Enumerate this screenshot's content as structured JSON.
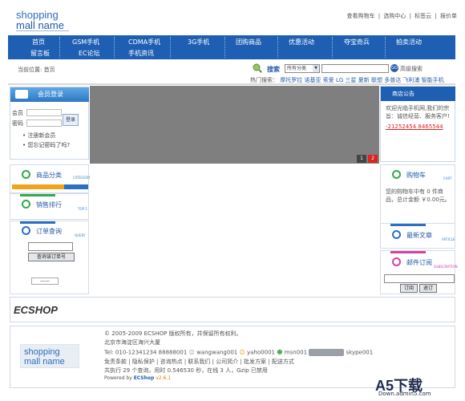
{
  "logo": {
    "line1": "shopping",
    "line2": "mall name"
  },
  "toplinks": [
    "查看购物车",
    "|",
    "选购中心",
    "|",
    "标签云",
    "|",
    "报价单"
  ],
  "nav": {
    "row1": [
      "首页",
      "GSM手机",
      "CDMA手机",
      "3G手机",
      "团购商品",
      "优惠活动",
      "夺宝奇兵",
      "拍卖活动"
    ],
    "row2": [
      "留言板",
      "EC论坛",
      "手机资讯"
    ]
  },
  "breadcrumb": "当前位置: 首页",
  "search": {
    "label": "搜索",
    "category_selected": "所有分类",
    "advanced_label": "高级搜索",
    "hot_prefix": "热门搜索：",
    "hot_words": [
      "摩托罗拉",
      "诺基亚",
      "索爱",
      "LG",
      "三星",
      "夏新",
      "联想",
      "多普达",
      "飞利浦",
      "智能手机"
    ]
  },
  "login": {
    "title": "会员登录",
    "user_label": "会员",
    "pass_label": "密码",
    "login_button": "登录",
    "register_link": "注册新会员",
    "forgot_link": "您忘记密码了吗?"
  },
  "banner": {
    "pages": [
      "1",
      "2"
    ]
  },
  "notice": {
    "title": "商店公告",
    "text": "欢迎光临手机网,我们的宗旨：诚信经营、服务客户!",
    "phone": "-21252454 8465544"
  },
  "left": {
    "category_title": "商品分类",
    "category_tag": "CATEGORY",
    "top10_title": "销售排行",
    "top10_tag": "TOP 5",
    "order_title": "订单查询",
    "order_tag": "QUERY",
    "order_button": "查询该订单号",
    "vote_input": "——"
  },
  "right": {
    "cart_title": "购物车",
    "cart_tag": "CART",
    "cart_text": "您的购物车中有 0 件商品，总计金额 ￥0.00元。",
    "article_title": "最新文章",
    "article_tag": "ARTICLE",
    "subscribe_title": "邮件订阅",
    "subscribe_tag": "SUBSCRIPTION",
    "subscribe_button": "订阅",
    "unsubscribe_button": "退订"
  },
  "ecshop": {
    "text": "ECSHOP"
  },
  "footer": {
    "copyright": "© 2005-2009 ECSHOP 版权所有，并保留所有权利。",
    "address": "北京市海淀区海兴大厦",
    "tel_line": "Tel: 010-12341234    88888001",
    "ww": "wangwang001",
    "yahoo": "yaho0001",
    "msn": "msn001",
    "skype": "skype001",
    "links": "免责条款 | 隐私保护 | 咨询热点 | 联系我们 | 公司简介 | 批发方案 | 配送方式",
    "stats": "共执行 29 个查询，用时 0.546530 秒，在线 3 人，Gzip 已禁用",
    "powered": "Powered by ",
    "powered_brand": "ECShop",
    "version": "v2.6.1",
    "logo_line1": "shopping",
    "logo_line2": "mall name"
  },
  "watermark": {
    "brand": "A5下载",
    "url": "Down.admin5.com"
  },
  "colors": {
    "nav": "#1e5fb3",
    "panel": "#3a87d0",
    "banner": "#7f7f7f",
    "accent_red": "#d22"
  }
}
